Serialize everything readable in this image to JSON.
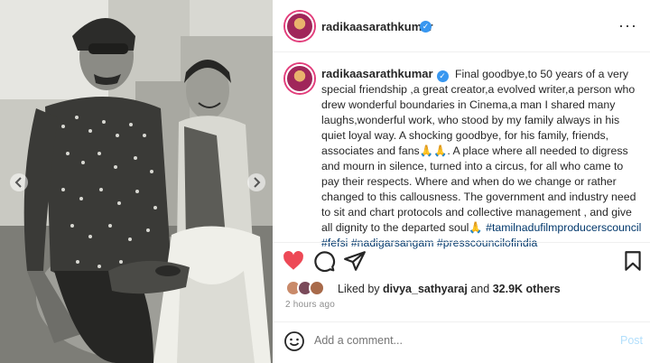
{
  "post": {
    "username": "radikaasarathkumar",
    "verified_glyph": "✓",
    "caption": {
      "username": "radikaasarathkumar",
      "text": "Final goodbye,to 50 years of a very special friendship ,a great creator,a evolved writer,a person who drew wonderful boundaries in Cinema,a man I shared many laughs,wonderful work, who stood by my family always in his quiet loyal way. A shocking goodbye, for his family, friends, associates and fans🙏🙏. A place where all needed to digress and mourn in silence, turned into a circus, for all who came to pay their respects. Where and when do we change or rather changed to this callousness. The government and industry need to sit and chart protocols and collective management , and give all dignity to the departed soul🙏",
      "hashtags": [
        "#tamilnadufilmproducerscouncil",
        "#fefsi",
        "#nadigarsangam",
        "#presscouncilofindia"
      ]
    },
    "likes": {
      "prefix": "Liked by",
      "user": "divya_sathyaraj",
      "connector": "and",
      "count": "32.9K others"
    },
    "time_ago": "2 hours ago",
    "comment_placeholder": "Add a comment...",
    "post_label": "Post",
    "more_glyph": "···"
  },
  "icons": [
    "heart-icon",
    "comment-icon",
    "share-icon",
    "bookmark-icon",
    "emoji-icon",
    "carousel-prev-icon",
    "carousel-next-icon"
  ],
  "colors": {
    "like_red": "#ed4956",
    "link_blue": "#00376b",
    "verified_blue": "#3897f0",
    "post_blue_disabled": "#b2dffc",
    "muted_gray": "#8e8e8e"
  }
}
